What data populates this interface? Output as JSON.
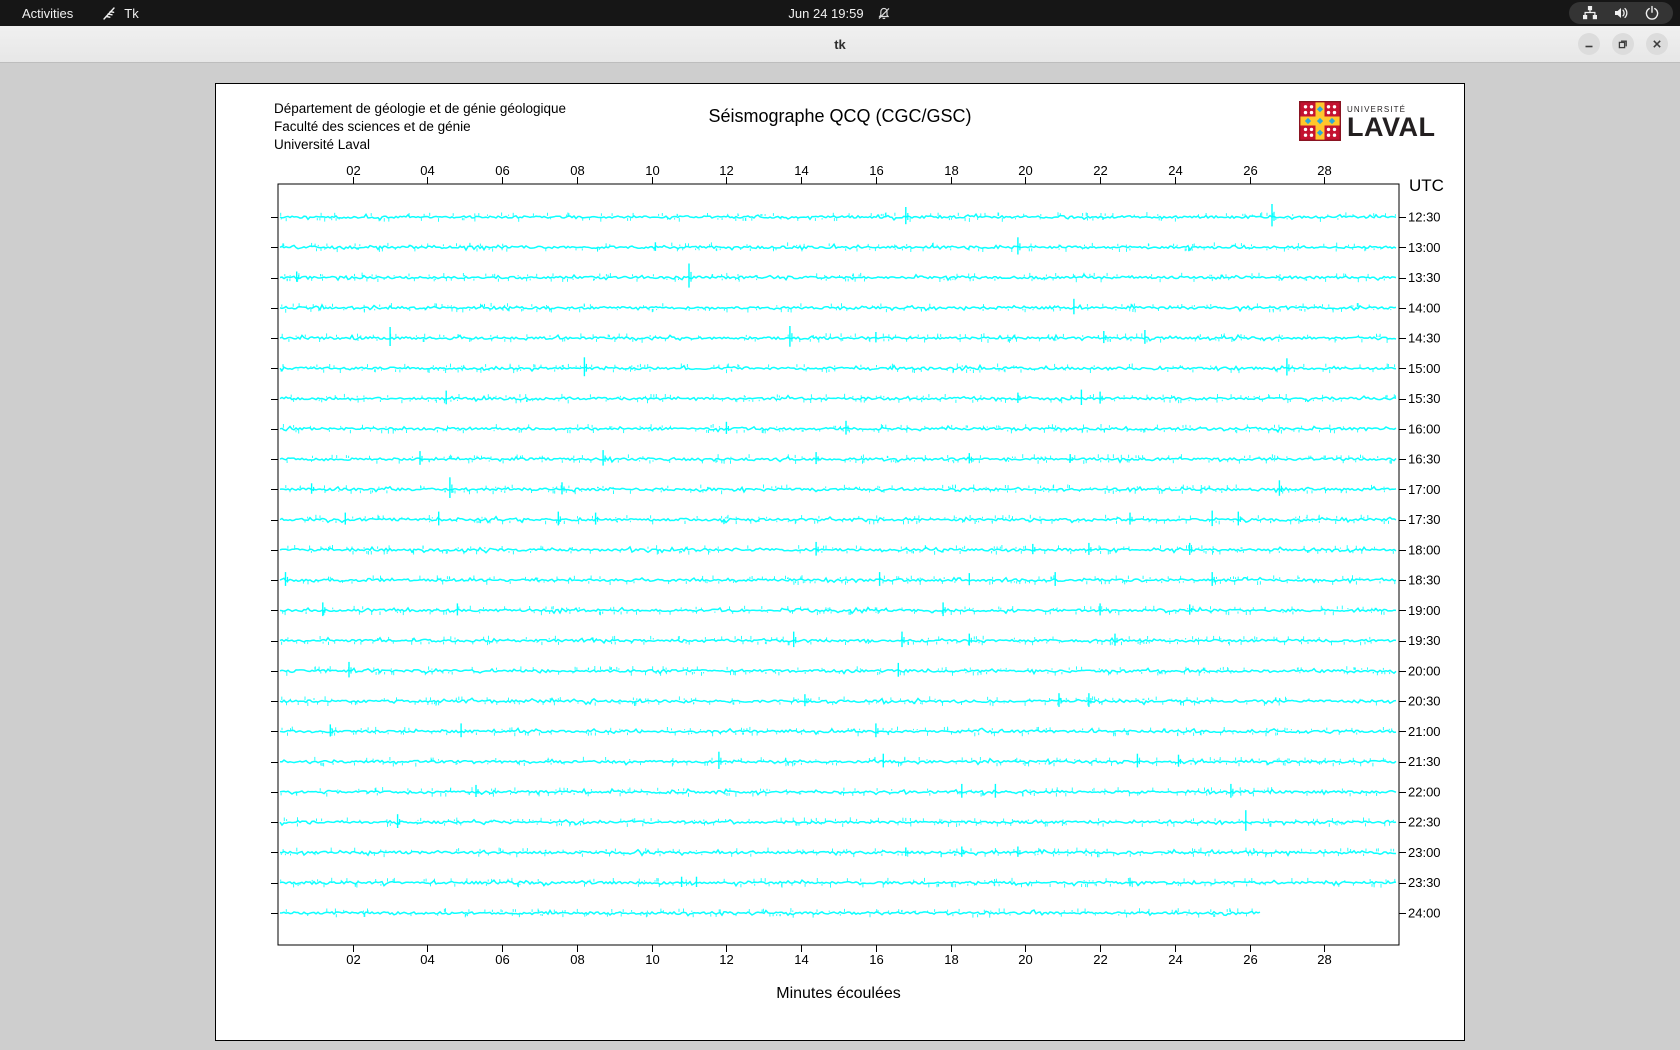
{
  "top_bar": {
    "activities": "Activities",
    "app_name": "Tk",
    "clock": "Jun 24 19:59",
    "icons": [
      "tk-feather-icon",
      "notifications-off-icon"
    ]
  },
  "system_tray": {
    "icons": [
      "network-wired-icon",
      "volume-icon",
      "power-icon"
    ]
  },
  "window": {
    "title": "tk",
    "controls": [
      "minimize",
      "maximize",
      "close"
    ]
  },
  "header": {
    "lines": [
      "Département de géologie et de génie géologique",
      "Faculté des sciences et de génie",
      "Université Laval"
    ]
  },
  "plot_title": "Séismographe QCQ (CGC/GSC)",
  "logo": {
    "line1": "UNIVERSITÉ",
    "line2": "LAVAL",
    "shield_red": "#c41230",
    "shield_gold": "#ffc72c",
    "shield_blue": "#2aa8d8"
  },
  "colors": {
    "trace": "#00ffff",
    "utc_label": "#ff0000",
    "axis": "#000000",
    "desktop": "#cecece",
    "topbar": "#161616",
    "titlebar": "#ececec"
  },
  "chart_data": {
    "type": "line",
    "title": "Séismographe QCQ (CGC/GSC)",
    "xlabel": "Minutes écoulées",
    "trace_color": "#00ffff",
    "noise_seed": 7,
    "x_axis": {
      "range_minutes": [
        0,
        30
      ],
      "tick_minutes": [
        2,
        4,
        6,
        8,
        10,
        12,
        14,
        16,
        18,
        20,
        22,
        24,
        26,
        28
      ],
      "tick_labels": [
        "02",
        "04",
        "06",
        "08",
        "10",
        "12",
        "14",
        "16",
        "18",
        "20",
        "22",
        "24",
        "26",
        "28"
      ]
    },
    "y_axis": {
      "label": "UTC",
      "label_color": "#ff0000"
    },
    "rows": [
      {
        "utc": "12:30",
        "spikes": [
          [
            16.8,
            10
          ],
          [
            26.6,
            13
          ]
        ]
      },
      {
        "utc": "13:00",
        "spikes": [
          [
            10.1,
            5
          ],
          [
            19.8,
            10
          ]
        ]
      },
      {
        "utc": "13:30",
        "spikes": [
          [
            0.5,
            6
          ],
          [
            11.0,
            14
          ]
        ]
      },
      {
        "utc": "14:00",
        "spikes": [
          [
            21.3,
            9
          ]
        ]
      },
      {
        "utc": "14:30",
        "spikes": [
          [
            3.0,
            11
          ],
          [
            13.7,
            12
          ],
          [
            16.0,
            6
          ],
          [
            22.1,
            7
          ],
          [
            23.2,
            8
          ]
        ]
      },
      {
        "utc": "15:00",
        "spikes": [
          [
            8.2,
            11
          ],
          [
            27.0,
            10
          ]
        ]
      },
      {
        "utc": "15:30",
        "spikes": [
          [
            4.5,
            8
          ],
          [
            19.8,
            6
          ],
          [
            21.5,
            9
          ],
          [
            22.0,
            7
          ]
        ]
      },
      {
        "utc": "16:00",
        "spikes": [
          [
            12.0,
            7
          ],
          [
            15.2,
            8
          ]
        ]
      },
      {
        "utc": "16:30",
        "spikes": [
          [
            3.8,
            8
          ],
          [
            8.7,
            9
          ],
          [
            14.4,
            7
          ],
          [
            18.5,
            6
          ],
          [
            21.2,
            5
          ]
        ]
      },
      {
        "utc": "17:00",
        "spikes": [
          [
            0.9,
            6
          ],
          [
            4.6,
            12
          ],
          [
            7.6,
            7
          ],
          [
            26.8,
            9
          ]
        ]
      },
      {
        "utc": "17:30",
        "spikes": [
          [
            1.8,
            7
          ],
          [
            4.3,
            8
          ],
          [
            7.5,
            8
          ],
          [
            8.5,
            7
          ],
          [
            22.8,
            7
          ],
          [
            25.0,
            9
          ],
          [
            25.7,
            8
          ]
        ]
      },
      {
        "utc": "18:00",
        "spikes": [
          [
            14.4,
            8
          ],
          [
            20.2,
            6
          ],
          [
            21.7,
            7
          ],
          [
            24.4,
            7
          ]
        ]
      },
      {
        "utc": "18:30",
        "spikes": [
          [
            0.2,
            8
          ],
          [
            16.1,
            8
          ],
          [
            18.5,
            7
          ],
          [
            20.8,
            8
          ],
          [
            25.0,
            8
          ]
        ]
      },
      {
        "utc": "19:00",
        "spikes": [
          [
            1.2,
            8
          ],
          [
            4.8,
            7
          ],
          [
            17.8,
            8
          ],
          [
            22.0,
            7
          ],
          [
            24.4,
            6
          ]
        ]
      },
      {
        "utc": "19:30",
        "spikes": [
          [
            13.8,
            9
          ],
          [
            16.7,
            9
          ],
          [
            18.5,
            7
          ],
          [
            22.4,
            7
          ]
        ]
      },
      {
        "utc": "20:00",
        "spikes": [
          [
            1.9,
            9
          ],
          [
            16.6,
            8
          ]
        ]
      },
      {
        "utc": "20:30",
        "spikes": [
          [
            14.1,
            7
          ],
          [
            20.9,
            8
          ],
          [
            21.7,
            8
          ]
        ]
      },
      {
        "utc": "21:00",
        "spikes": [
          [
            1.4,
            7
          ],
          [
            4.9,
            8
          ],
          [
            16.0,
            8
          ]
        ]
      },
      {
        "utc": "21:30",
        "spikes": [
          [
            11.8,
            10
          ],
          [
            16.2,
            8
          ],
          [
            23.0,
            8
          ],
          [
            24.1,
            7
          ]
        ]
      },
      {
        "utc": "22:00",
        "spikes": [
          [
            5.3,
            7
          ],
          [
            18.3,
            8
          ],
          [
            19.2,
            8
          ],
          [
            25.5,
            8
          ]
        ]
      },
      {
        "utc": "22:30",
        "spikes": [
          [
            3.2,
            8
          ],
          [
            25.9,
            12
          ]
        ]
      },
      {
        "utc": "23:00",
        "spikes": [
          [
            16.8,
            5
          ],
          [
            18.3,
            6
          ],
          [
            19.8,
            6
          ]
        ]
      },
      {
        "utc": "23:30",
        "spikes": [
          [
            10.8,
            6
          ],
          [
            11.2,
            6
          ],
          [
            22.8,
            5
          ]
        ]
      },
      {
        "utc": "24:00",
        "spikes": [],
        "end_minute": 26.3
      }
    ]
  }
}
